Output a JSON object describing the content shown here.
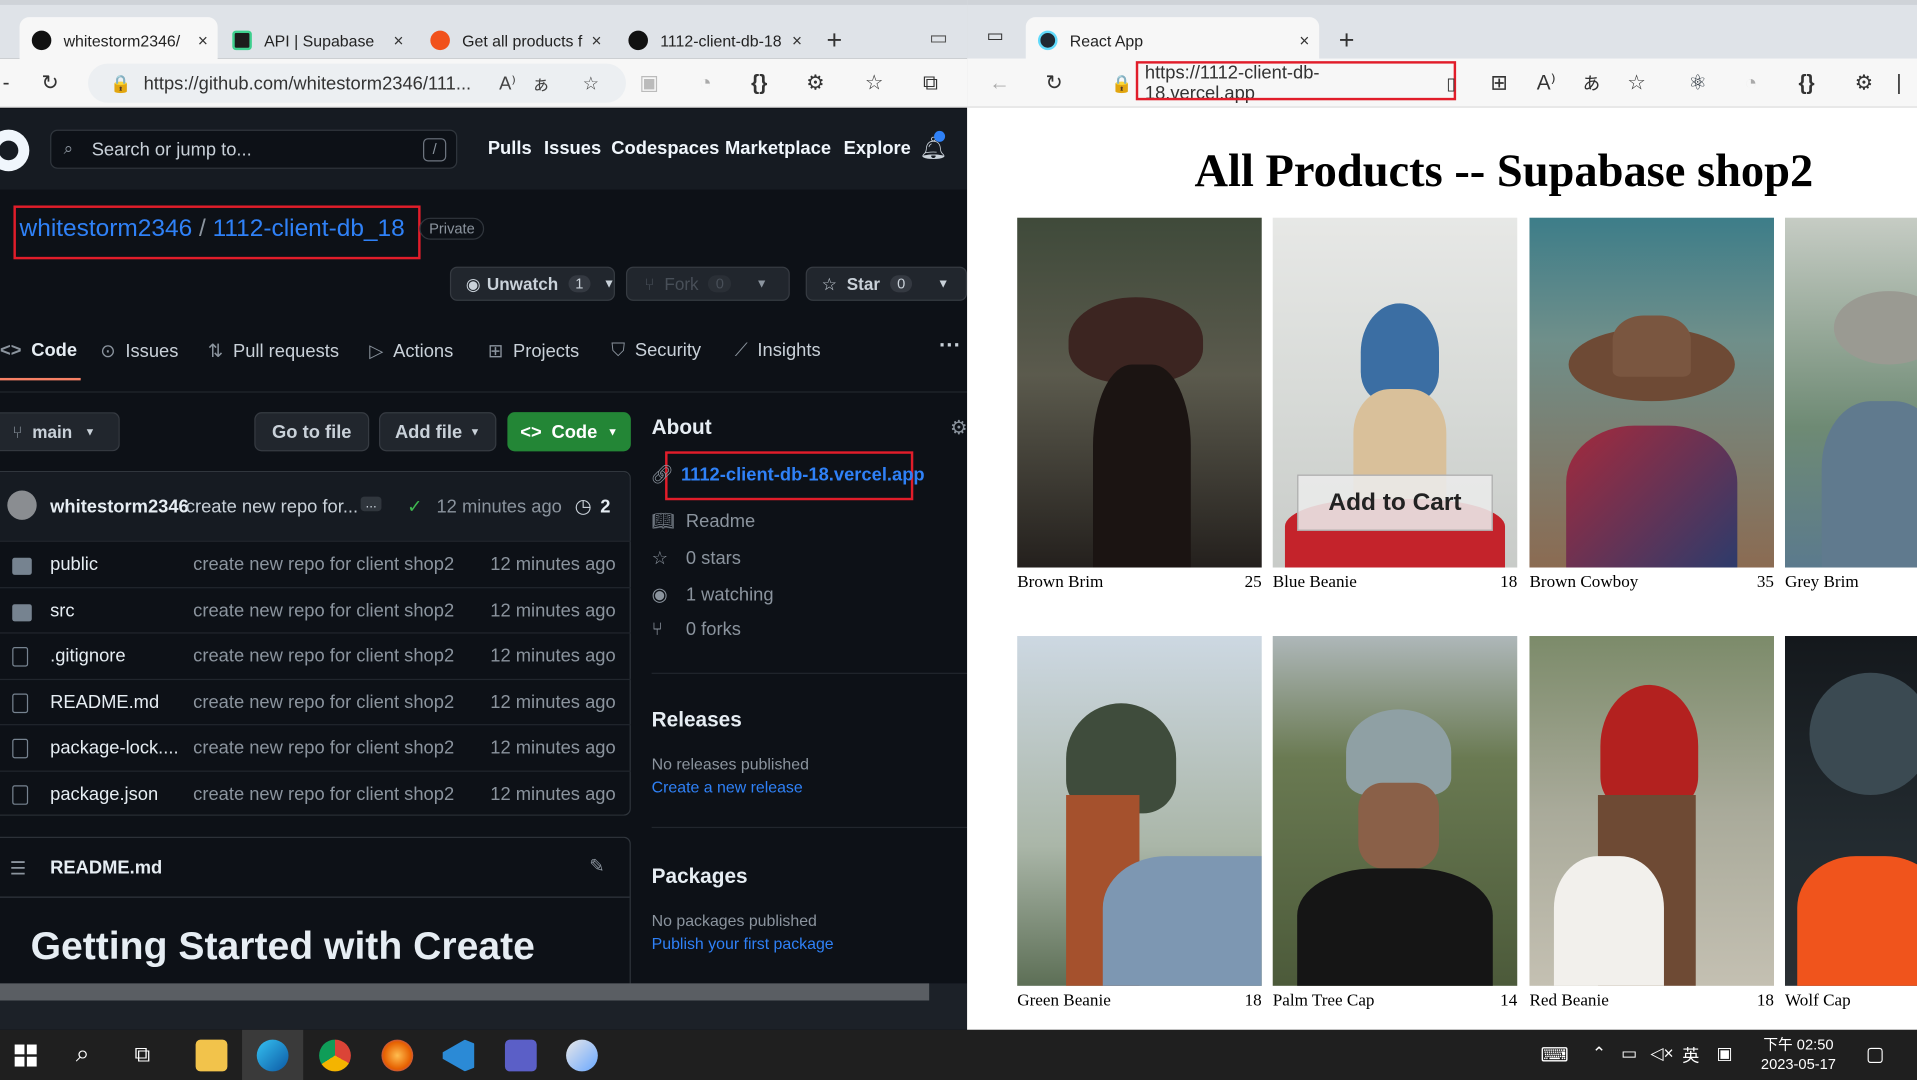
{
  "left_browser": {
    "tabs": [
      {
        "label": "whitestorm2346/",
        "close": "×"
      },
      {
        "label": "API | Supabase",
        "close": "×"
      },
      {
        "label": "Get all products f",
        "close": "×"
      },
      {
        "label": "1112-client-db-18",
        "close": "×"
      }
    ],
    "new_tab": "+",
    "address": "https://github.com/whitestorm2346/111..."
  },
  "github": {
    "search_placeholder": "Search or jump to...",
    "search_shortcut": "/",
    "nav": [
      "Pulls",
      "Issues",
      "Codespaces",
      "Marketplace",
      "Explore"
    ],
    "owner": "whitestorm2346",
    "separator": "/",
    "repo": "1112-client-db_18",
    "visibility": "Private",
    "unwatch": {
      "label": "Unwatch",
      "count": "1"
    },
    "fork": {
      "label": "Fork",
      "count": "0"
    },
    "star": {
      "label": "Star",
      "count": "0"
    },
    "tabs": [
      {
        "label": "Code",
        "icon": "code-icon"
      },
      {
        "label": "Issues",
        "icon": "issue-icon"
      },
      {
        "label": "Pull requests",
        "icon": "pull-request-icon"
      },
      {
        "label": "Actions",
        "icon": "play-icon"
      },
      {
        "label": "Projects",
        "icon": "table-icon"
      },
      {
        "label": "Security",
        "icon": "shield-icon"
      },
      {
        "label": "Insights",
        "icon": "graph-icon"
      }
    ],
    "more": "···",
    "branch": "main",
    "go_to_file": "Go to file",
    "add_file": "Add file",
    "code_button": "Code",
    "commit": {
      "author": "whitestorm2346",
      "message": "create new repo for...",
      "ellipsis": "...",
      "time": "12 minutes ago",
      "count": "2"
    },
    "files": [
      {
        "name": "public",
        "type": "folder",
        "message": "create new repo for client shop2",
        "time": "12 minutes ago"
      },
      {
        "name": "src",
        "type": "folder",
        "message": "create new repo for client shop2",
        "time": "12 minutes ago"
      },
      {
        "name": ".gitignore",
        "type": "file",
        "message": "create new repo for client shop2",
        "time": "12 minutes ago"
      },
      {
        "name": "README.md",
        "type": "file",
        "message": "create new repo for client shop2",
        "time": "12 minutes ago"
      },
      {
        "name": "package-lock....",
        "type": "file",
        "message": "create new repo for client shop2",
        "time": "12 minutes ago"
      },
      {
        "name": "package.json",
        "type": "file",
        "message": "create new repo for client shop2",
        "time": "12 minutes ago"
      }
    ],
    "readme_title": "README.md",
    "readme_heading": "Getting Started with Create",
    "about": {
      "title": "About",
      "link": "1112-client-db-18.vercel.app",
      "readme": "Readme",
      "stars": "0 stars",
      "watching": "1 watching",
      "forks": "0 forks"
    },
    "releases": {
      "title": "Releases",
      "none": "No releases published",
      "create": "Create a new release"
    },
    "packages": {
      "title": "Packages",
      "none": "No packages published",
      "publish": "Publish your first package"
    }
  },
  "right_browser": {
    "tab": {
      "label": "React App",
      "close": "×"
    },
    "new_tab": "+",
    "address": "https://1112-client-db-18.vercel.app",
    "heading": "All Products -- Supabase shop2",
    "add_to_cart": "Add to Cart",
    "products": [
      {
        "name": "Brown Brim",
        "price": "25"
      },
      {
        "name": "Blue Beanie",
        "price": "18"
      },
      {
        "name": "Brown Cowboy",
        "price": "35"
      },
      {
        "name": "Grey Brim",
        "price": ""
      },
      {
        "name": "Green Beanie",
        "price": "18"
      },
      {
        "name": "Palm Tree Cap",
        "price": "14"
      },
      {
        "name": "Red Beanie",
        "price": "18"
      },
      {
        "name": "Wolf Cap",
        "price": ""
      }
    ]
  },
  "taskbar": {
    "time_prefix": "下午",
    "time": "02:50",
    "date": "2023-05-17",
    "ime": "英"
  }
}
